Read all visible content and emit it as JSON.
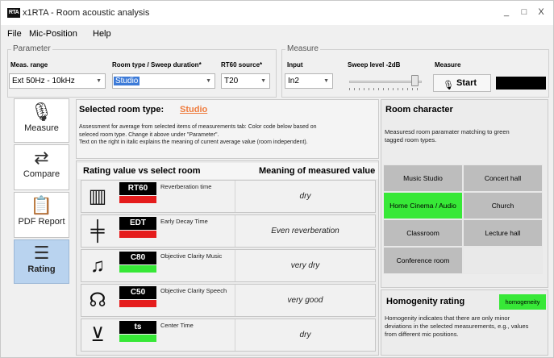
{
  "window": {
    "title": "x1RTA - Room acoustic analysis",
    "icon_text": "RTA",
    "minimize": "_",
    "restore": "□",
    "close": "X"
  },
  "menu": [
    "File",
    "Mic-Position",
    "Help"
  ],
  "parameter": {
    "group_title": "Parameter",
    "meas_range_label": "Meas. range",
    "meas_range_value": "Ext 50Hz - 10kHz",
    "room_type_label": "Room type / Sweep duration*",
    "room_type_value": "Studio",
    "rt60_source_label": "RT60 source*",
    "rt60_source_value": "T20"
  },
  "measure": {
    "group_title": "Measure",
    "input_label": "Input",
    "input_value": "In2",
    "sweep_label": "Sweep level -2dB",
    "sweep_level": 0.88,
    "measure_label": "Measure",
    "start_label": "Start"
  },
  "tabs": [
    {
      "label": "Measure",
      "icon": "microphone-icon"
    },
    {
      "label": "Compare",
      "icon": "compare-icon"
    },
    {
      "label": "PDF Report",
      "icon": "clipboard-icon"
    },
    {
      "label": "Rating",
      "icon": "rating-list-icon",
      "active": true
    }
  ],
  "selected_room": {
    "title": "Selected room type:",
    "value": "Studio",
    "assessment_line1": "Assessment for average from selected items of measurements tab: Color code below based on",
    "assessment_line2": "seleced room type.  Change it above under \"Parameter\".",
    "assessment_line3": "Text on the right in italic explains the meaning of current average value (room independent)."
  },
  "rating": {
    "header_left": "Rating value vs select room",
    "header_right": "Meaning of measured value",
    "rows": [
      {
        "badge": "RT60",
        "desc": "Reverberation time",
        "meaning": "dry",
        "status_color": "#e51c1c",
        "icon": "reverberation-icon"
      },
      {
        "badge": "EDT",
        "desc": "Early Decay Time",
        "meaning": "Even reverberation",
        "status_color": "#e51c1c",
        "icon": "early-decay-icon"
      },
      {
        "badge": "C80",
        "desc": "Objective Clarity Music",
        "meaning": "very dry",
        "status_color": "#37e837",
        "icon": "music-note-icon"
      },
      {
        "badge": "C50",
        "desc": "Objective Clarity Speech",
        "meaning": "very good",
        "status_color": "#e51c1c",
        "icon": "speech-icon"
      },
      {
        "badge": "ts",
        "desc": "Center Time",
        "meaning": "dry",
        "status_color": "#37e837",
        "icon": "center-time-icon"
      }
    ]
  },
  "room_character": {
    "title": "Room character",
    "desc_line1": "Measuresd room paramater matching to green",
    "desc_line2": "tagged room types.",
    "rooms": [
      {
        "label": "Music Studio",
        "match": false
      },
      {
        "label": "Concert hall",
        "match": false
      },
      {
        "label": "Home Cinema / Audio",
        "match": true
      },
      {
        "label": "Church",
        "match": false
      },
      {
        "label": "Classroom",
        "match": false
      },
      {
        "label": "Lecture hall",
        "match": false
      },
      {
        "label": "Conference room",
        "match": false
      }
    ]
  },
  "homogenity": {
    "title": "Homogenity rating",
    "badge": "homogeneity",
    "desc_line1": "Homogenity indicates that there are only minor",
    "desc_line2": "deviations in the selected measurements, e.g., values",
    "desc_line3": "from different mic positions."
  },
  "colors": {
    "accent_orange": "#ef7b3c",
    "status_red": "#e51c1c",
    "status_green": "#37e837",
    "active_tab": "#b9d3ef"
  }
}
